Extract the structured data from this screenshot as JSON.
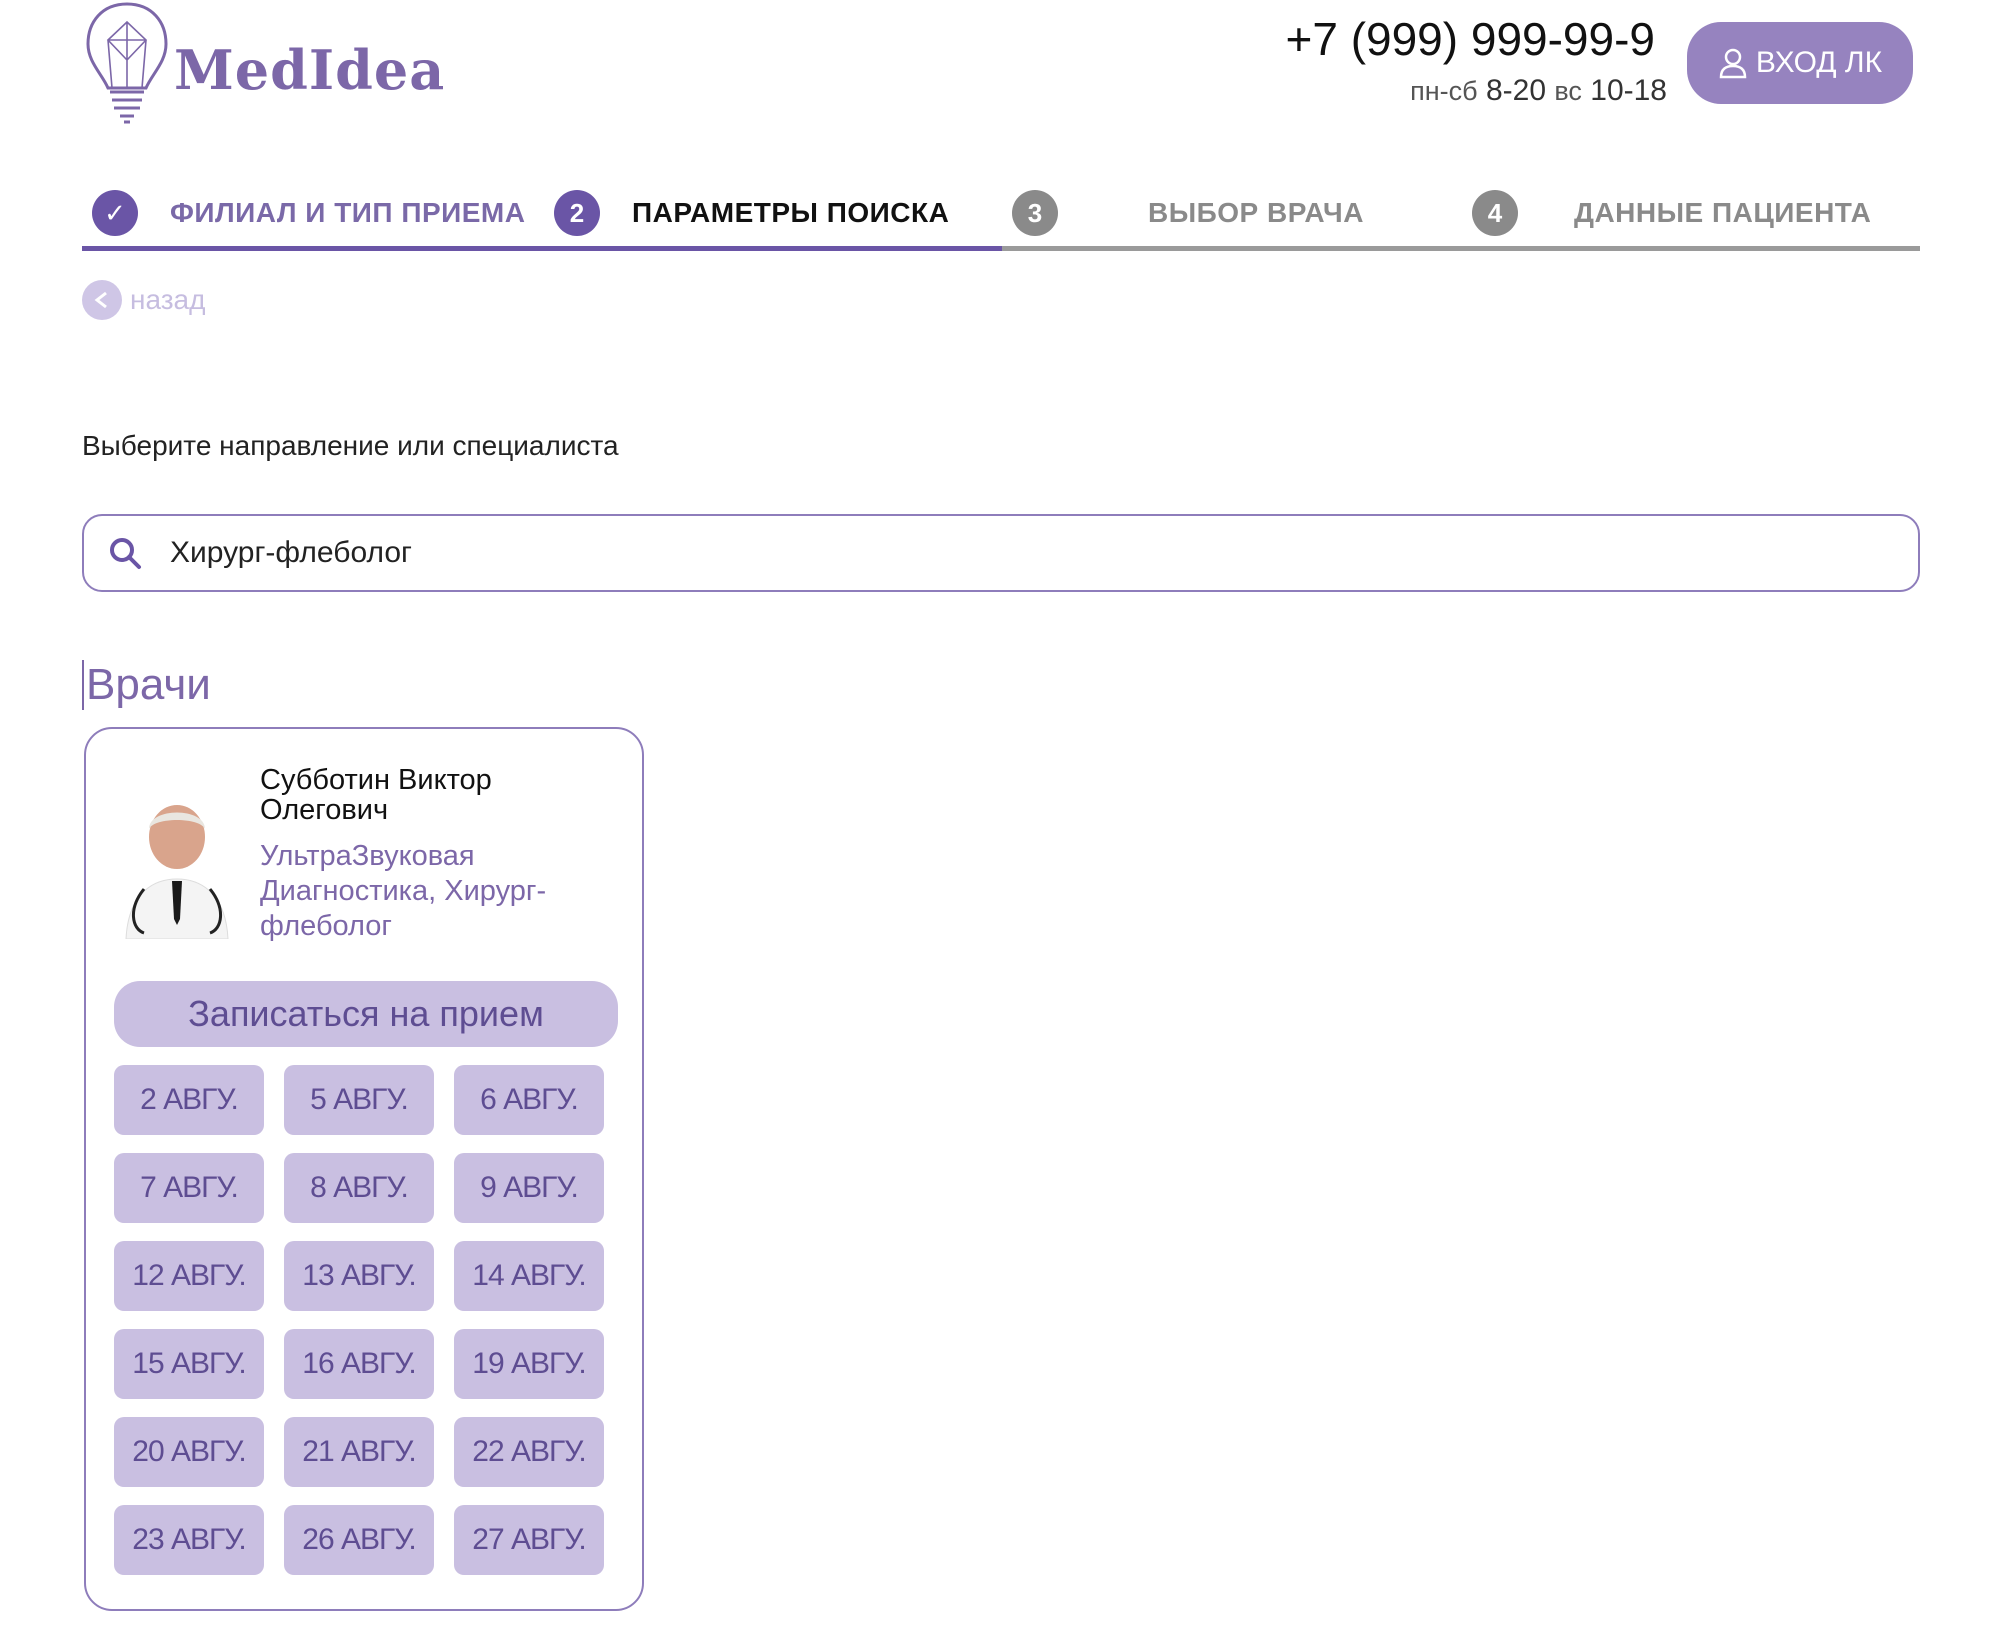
{
  "header": {
    "logo_text": "MedIdea",
    "phone": "+7 (999) 999-99-9",
    "hours": [
      {
        "label": "пн-сб",
        "time": "8-20"
      },
      {
        "label": "вс",
        "time": "10-18"
      }
    ],
    "login_label": "ВХОД ЛК"
  },
  "steps": [
    {
      "num": "✓",
      "label": "ФИЛИАЛ И ТИП ПРИЕМА",
      "state": "done"
    },
    {
      "num": "2",
      "label": "ПАРАМЕТРЫ ПОИСКА",
      "state": "current"
    },
    {
      "num": "3",
      "label": "ВЫБОР ВРАЧА",
      "state": "future"
    },
    {
      "num": "4",
      "label": "ДАННЫЕ ПАЦИЕНТА",
      "state": "future"
    }
  ],
  "back_label": "назад",
  "prompt": "Выберите направление или специалиста",
  "search": {
    "value": "Хирург-флеболог"
  },
  "section_title": "Врачи",
  "doctor": {
    "name": "Субботин Виктор Олегович",
    "specialty": "УльтраЗвуковая Диагностика, Хирург-флеболог",
    "book_label": "Записаться на прием",
    "dates": [
      "2 АВГУ.",
      "5 АВГУ.",
      "6 АВГУ.",
      "7 АВГУ.",
      "8 АВГУ.",
      "9 АВГУ.",
      "12 АВГУ.",
      "13 АВГУ.",
      "14 АВГУ.",
      "15 АВГУ.",
      "16 АВГУ.",
      "19 АВГУ.",
      "20 АВГУ.",
      "21 АВГУ.",
      "22 АВГУ.",
      "23 АВГУ.",
      "26 АВГУ.",
      "27 АВГУ."
    ]
  },
  "colors": {
    "accent": "#6a55a6",
    "accent_light": "#c9bfe1",
    "brand": "#7c67a8",
    "inactive": "#8a8a8a"
  }
}
